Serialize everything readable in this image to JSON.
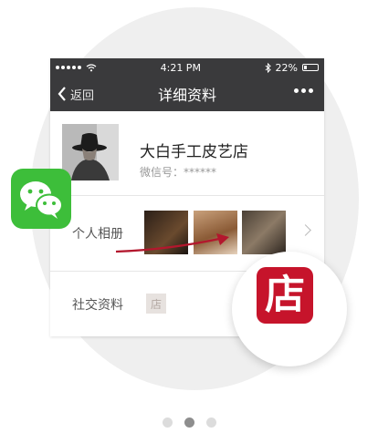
{
  "status_bar": {
    "carrier_dots": 5,
    "time": "4:21 PM",
    "battery_percent": "22%",
    "battery_level": 0.22
  },
  "nav": {
    "back_label": "返回",
    "title": "详细资料"
  },
  "profile": {
    "name": "大白手工皮艺店",
    "wechat_id_label": "微信号：",
    "wechat_id_value": "******"
  },
  "album": {
    "label": "个人相册",
    "photo_count": 3
  },
  "social": {
    "label": "社交资料",
    "chip_text": "店"
  },
  "store_app": {
    "icon_text": "店",
    "color": "#c6142b"
  },
  "wechat_app": {
    "color": "#3dbe3a",
    "icon": "wechat-icon"
  },
  "pager": {
    "pages": 3,
    "active_index": 1
  },
  "colors": {
    "nav_bg": "#3a3a3c",
    "accent_red": "#c6142b",
    "wechat_green": "#3dbe3a",
    "page_bg_circle": "#efefef"
  }
}
